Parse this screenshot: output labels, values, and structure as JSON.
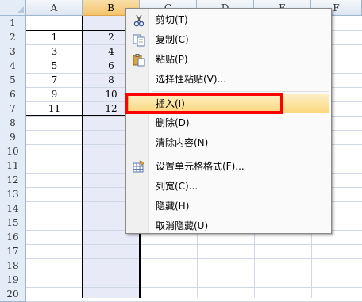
{
  "spreadsheet": {
    "columns": [
      "A",
      "B",
      "C",
      "D",
      "E",
      "F"
    ],
    "selected_column": "B",
    "rows": [
      "1",
      "2",
      "3",
      "4",
      "5",
      "6",
      "7",
      "8",
      "9",
      "10",
      "11",
      "12",
      "13",
      "14",
      "15",
      "16",
      "17",
      "18",
      "19",
      "20"
    ],
    "cells": [
      {
        "a": "",
        "b": ""
      },
      {
        "a": "1",
        "b": "2"
      },
      {
        "a": "3",
        "b": "4"
      },
      {
        "a": "5",
        "b": "6"
      },
      {
        "a": "7",
        "b": "8"
      },
      {
        "a": "9",
        "b": "10"
      },
      {
        "a": "11",
        "b": "12"
      }
    ]
  },
  "context_menu": {
    "items": [
      {
        "label": "剪切(T)",
        "icon": "scissors-icon"
      },
      {
        "label": "复制(C)",
        "icon": "copy-icon"
      },
      {
        "label": "粘贴(P)",
        "icon": "paste-icon"
      },
      {
        "label": "选择性粘贴(V)..."
      },
      {
        "label": "插入(I)",
        "highlighted": true
      },
      {
        "label": "删除(D)"
      },
      {
        "label": "清除内容(N)"
      },
      {
        "label": "设置单元格格式(F)...",
        "icon": "format-cells-icon"
      },
      {
        "label": "列宽(C)..."
      },
      {
        "label": "隐藏(H)"
      },
      {
        "label": "取消隐藏(U)"
      }
    ],
    "highlight_color": "#ff0000"
  }
}
